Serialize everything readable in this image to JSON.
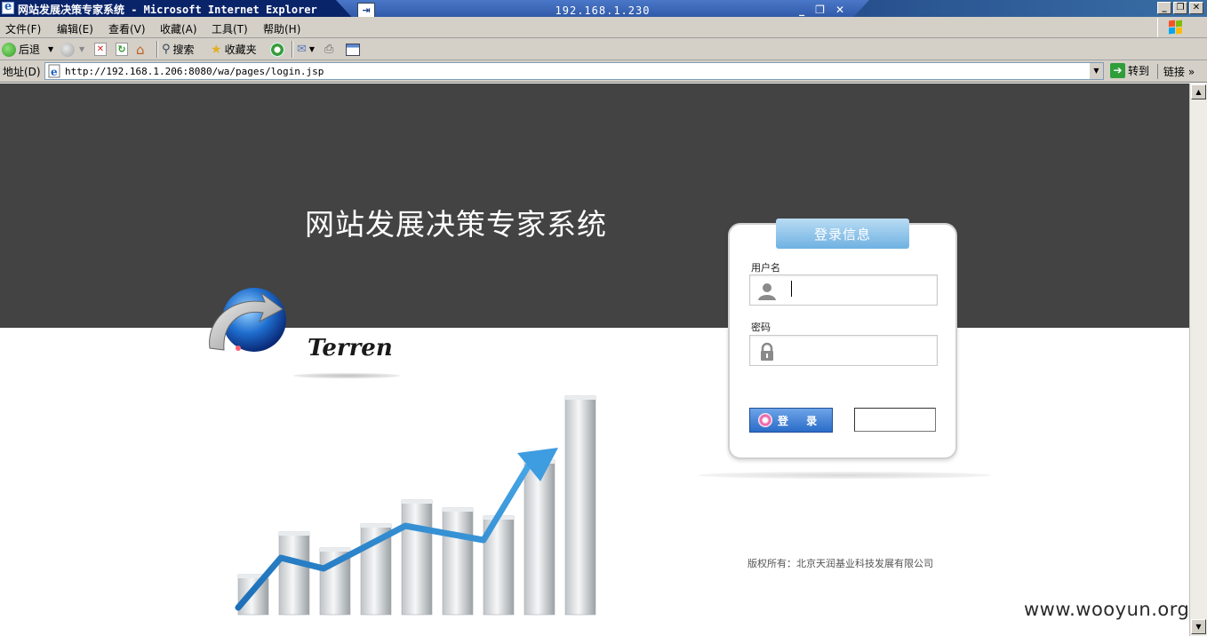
{
  "window": {
    "title": "网站发展决策专家系统 - Microsoft Internet Explorer",
    "buttons": [
      "_",
      "❐",
      "✕"
    ]
  },
  "rdp": {
    "pin_label": "⇥",
    "host": "192.168.1.230",
    "buttons": [
      "_",
      "❐",
      "✕"
    ]
  },
  "menu": {
    "items": [
      "文件(F)",
      "编辑(E)",
      "查看(V)",
      "收藏(A)",
      "工具(T)",
      "帮助(H)"
    ]
  },
  "toolbar": {
    "back_label": "后退",
    "search_label": "搜索",
    "favorites_label": "收藏夹"
  },
  "address": {
    "label": "地址(D)",
    "url": "http://192.168.1.206:8080/wa/pages/login.jsp",
    "go_label": "转到",
    "links_label": "链接 »"
  },
  "page": {
    "site_title": "网站发展决策专家系统",
    "brand": "Terren",
    "login": {
      "tab_title": "登录信息",
      "username_label": "用户名",
      "password_label": "密码",
      "username_value": "",
      "password_value": "",
      "button_label": "登 录"
    },
    "copyright": "版权所有：北京天润基业科技发展有限公司",
    "watermark": "www.wooyun.org"
  },
  "colors": {
    "dark_band": "#434343",
    "accent_blue": "#3a8fd0",
    "login_tab": "#7ab8e6"
  },
  "chart_art": {
    "bar_levels": [
      0.15,
      0.31,
      0.25,
      0.34,
      0.43,
      0.4,
      0.37,
      0.58,
      0.82
    ]
  }
}
